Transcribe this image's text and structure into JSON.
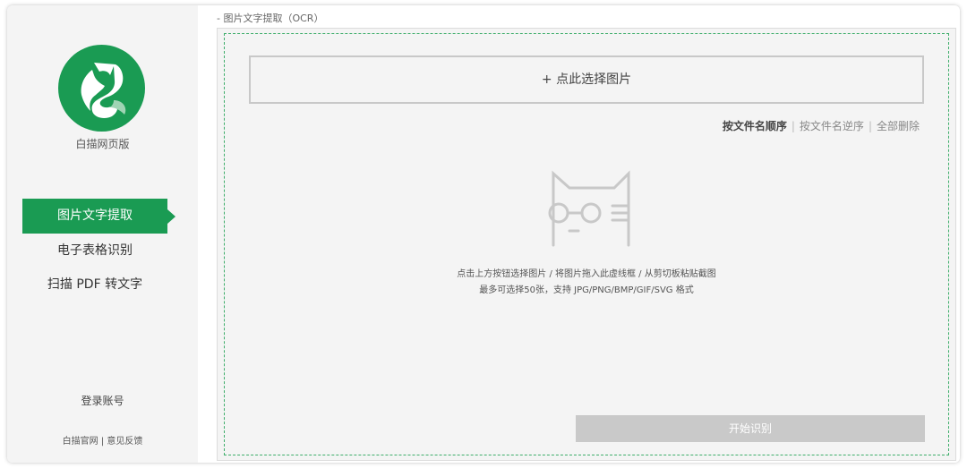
{
  "sidebar": {
    "app_name": "白描网页版",
    "nav": [
      {
        "label": "图片文字提取",
        "active": true
      },
      {
        "label": "电子表格识别",
        "active": false
      },
      {
        "label": "扫描 PDF 转文字",
        "active": false
      }
    ],
    "login_label": "登录账号",
    "footer": {
      "official": "白描官网",
      "separator": "|",
      "feedback": "意见反馈"
    }
  },
  "main": {
    "breadcrumb": "- 图片文字提取（OCR）",
    "select_button": "+ 点此选择图片",
    "sort": {
      "by_name_asc": "按文件名顺序",
      "by_name_desc": "按文件名逆序",
      "delete_all": "全部删除",
      "separator": "|"
    },
    "hint_line1": "点击上方按钮选择图片 / 将图片拖入此虚线框 / 从剪切板粘贴截图",
    "hint_line2": "最多可选择50张，支持 JPG/PNG/BMP/GIF/SVG 格式",
    "start_button": "开始识别"
  },
  "colors": {
    "brand_green": "#1a9b53",
    "dashed_border": "#3fae6b",
    "disabled_button": "#c9c9c9"
  },
  "icons": {
    "logo": "white-cat-logo-icon",
    "empty_state": "cat-with-glasses-icon",
    "nav_pointer": "triangle-right-icon"
  }
}
